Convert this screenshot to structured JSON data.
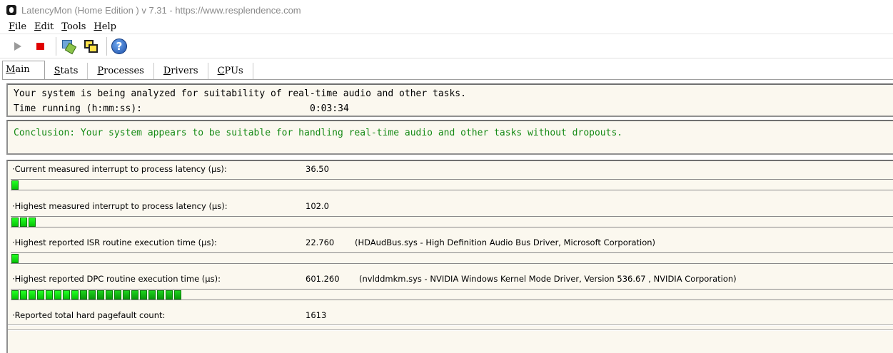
{
  "window": {
    "title": "LatencyMon  (Home Edition )  v 7.31 - https://www.resplendence.com"
  },
  "menu": [
    {
      "first": "F",
      "rest": "ile"
    },
    {
      "first": "E",
      "rest": "dit"
    },
    {
      "first": "T",
      "rest": "ools"
    },
    {
      "first": "H",
      "rest": "elp"
    }
  ],
  "toolbar": {
    "icons": [
      "play-icon",
      "stop-icon",
      "tools-icon",
      "windows-icon",
      "help-icon"
    ],
    "help_glyph": "?"
  },
  "tabs": [
    {
      "first": "M",
      "rest": "ain",
      "active": true
    },
    {
      "first": "S",
      "rest": "tats"
    },
    {
      "first": "P",
      "rest": "rocesses"
    },
    {
      "first": "D",
      "rest": "rivers"
    },
    {
      "first": "C",
      "rest": "PUs"
    }
  ],
  "status": {
    "line1": "Your system is being analyzed for suitability of real-time audio and other tasks.",
    "time_label": "Time running (h:mm:ss):",
    "time_value": "0:03:34"
  },
  "conclusion": "Conclusion: Your system appears to be suitable for handling real-time audio and other tasks without dropouts.",
  "metrics": [
    {
      "label": "·Current measured interrupt to process latency (µs):",
      "value": "36.50",
      "detail": "",
      "bar_segments": 1
    },
    {
      "label": "·Highest measured interrupt to process latency (µs):",
      "value": "102.0",
      "detail": "",
      "bar_segments": 3
    },
    {
      "label": "·Highest reported ISR routine execution time (µs):",
      "value": "22.760",
      "detail": "(HDAudBus.sys - High Definition Audio Bus Driver, Microsoft Corporation)",
      "bar_segments": 1
    },
    {
      "label": "·Highest reported DPC routine execution time (µs):",
      "value": "601.260",
      "detail": "(nvlddmkm.sys - NVIDIA Windows Kernel Mode Driver, Version 536.67 , NVIDIA Corporation)",
      "bar_segments": 20
    },
    {
      "label": "·Reported total hard pagefault count:",
      "value": "1613",
      "detail": "",
      "bar_segments": 0
    }
  ],
  "colors": {
    "conclusion_text": "#158a15",
    "bar_green": "#22ff22",
    "panel_bg": "#fbf8ef",
    "stop_red": "#e00000"
  }
}
